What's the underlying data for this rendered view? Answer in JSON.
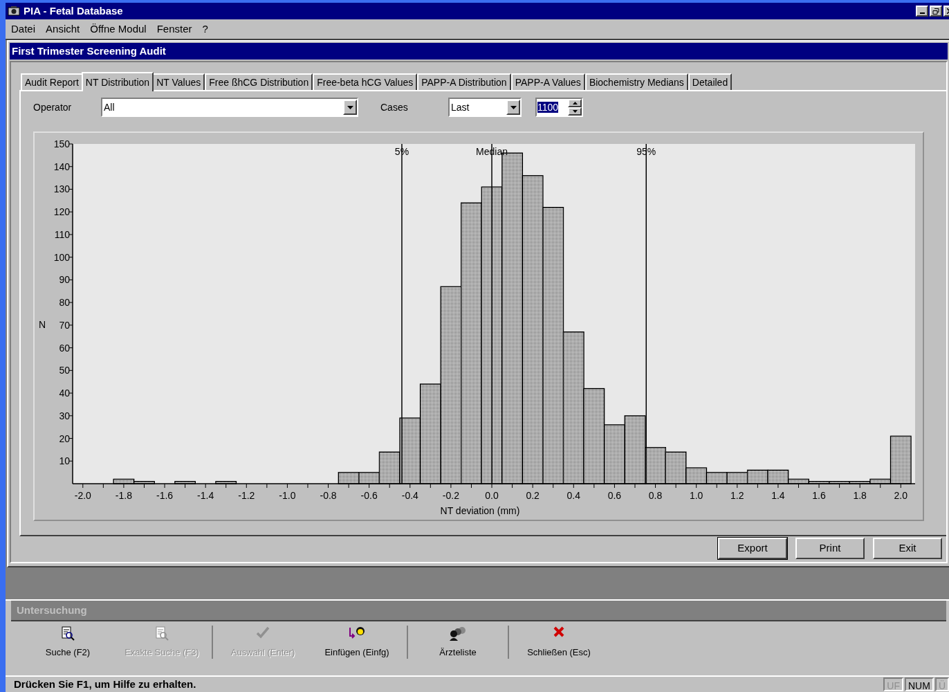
{
  "window": {
    "title": "PIA - Fetal Database"
  },
  "menu": [
    "Datei",
    "Ansicht",
    "Öffne Modul",
    "Fenster",
    "?"
  ],
  "child_window": {
    "title": "First Trimester Screening Audit"
  },
  "tabs": [
    {
      "label": "Audit Report",
      "selected": false
    },
    {
      "label": "NT Distribution",
      "selected": true
    },
    {
      "label": "NT Values",
      "selected": false
    },
    {
      "label": "Free ßhCG Distribution",
      "selected": false
    },
    {
      "label": "Free-beta hCG Values",
      "selected": false
    },
    {
      "label": "PAPP-A Distribution",
      "selected": false
    },
    {
      "label": "PAPP-A Values",
      "selected": false
    },
    {
      "label": "Biochemistry Medians",
      "selected": false
    },
    {
      "label": "Detailed",
      "selected": false
    }
  ],
  "filters": {
    "operator_label": "Operator",
    "operator": "All",
    "cases_label": "Cases",
    "cases": "Last",
    "count": "1100"
  },
  "chart_data": {
    "type": "bar",
    "xlabel": "NT deviation (mm)",
    "ylabel": "N",
    "x": [
      -2.0,
      -1.9,
      -1.8,
      -1.7,
      -1.6,
      -1.5,
      -1.4,
      -1.3,
      -1.2,
      -1.1,
      -1.0,
      -0.9,
      -0.8,
      -0.7,
      -0.6,
      -0.5,
      -0.4,
      -0.3,
      -0.2,
      -0.1,
      0.0,
      0.1,
      0.2,
      0.3,
      0.4,
      0.5,
      0.6,
      0.7,
      0.8,
      0.9,
      1.0,
      1.1,
      1.2,
      1.3,
      1.4,
      1.5,
      1.6,
      1.7,
      1.8,
      1.9,
      2.0
    ],
    "values": [
      0,
      0,
      2,
      1,
      0,
      1,
      0,
      1,
      0,
      0,
      0,
      0,
      0,
      5,
      5,
      14,
      29,
      44,
      87,
      124,
      131,
      146,
      136,
      122,
      67,
      42,
      26,
      30,
      16,
      14,
      7,
      5,
      5,
      6,
      6,
      2,
      1,
      1,
      1,
      2,
      21
    ],
    "xlim": [
      -2.05,
      2.07
    ],
    "ylim": [
      0,
      150
    ],
    "xticks": [
      {
        "value": -2.0,
        "label": "-2.0"
      },
      {
        "value": -1.8,
        "label": "-1.8"
      },
      {
        "value": -1.6,
        "label": "-1.6"
      },
      {
        "value": -1.4,
        "label": "-1.4"
      },
      {
        "value": -1.2,
        "label": "-1.2"
      },
      {
        "value": -1.0,
        "label": "-1.0"
      },
      {
        "value": -0.8,
        "label": "-0.8"
      },
      {
        "value": -0.6,
        "label": "-0.6"
      },
      {
        "value": -0.4,
        "label": "-0.4"
      },
      {
        "value": -0.2,
        "label": "-0.2"
      },
      {
        "value": 0.0,
        "label": "0.0"
      },
      {
        "value": 0.2,
        "label": "0.2"
      },
      {
        "value": 0.4,
        "label": "0.4"
      },
      {
        "value": 0.6,
        "label": "0.6"
      },
      {
        "value": 0.8,
        "label": "0.8"
      },
      {
        "value": 1.0,
        "label": "1.0"
      },
      {
        "value": 1.2,
        "label": "1.2"
      },
      {
        "value": 1.4,
        "label": "1.4"
      },
      {
        "value": 1.6,
        "label": "1.6"
      },
      {
        "value": 1.8,
        "label": "1.8"
      },
      {
        "value": 2.0,
        "label": "2.0"
      }
    ],
    "yticks": [
      10,
      20,
      30,
      40,
      50,
      60,
      70,
      80,
      90,
      100,
      110,
      120,
      130,
      140,
      150
    ],
    "ref_lines": [
      {
        "axis": "x",
        "value": -0.44
      },
      {
        "axis": "x",
        "value": 0.0
      },
      {
        "axis": "x",
        "value": 0.755
      }
    ]
  },
  "ref_line_labels": [
    "5%",
    "Median",
    "95%"
  ],
  "buttons": [
    {
      "label": "Export",
      "default": true
    },
    {
      "label": "Print",
      "default": false
    },
    {
      "label": "Exit",
      "default": false
    }
  ],
  "panel": {
    "title": "Untersuchung"
  },
  "toolbar": [
    [
      {
        "label": "Suche (F2)",
        "kind": "search",
        "disabled": false
      },
      {
        "label": "Exakte Suche (F3)",
        "kind": "search",
        "disabled": true
      }
    ],
    [
      {
        "label": "Auswahl (Enter)",
        "kind": "check",
        "disabled": true
      },
      {
        "label": "Einfügen (Einfg)",
        "kind": "insert",
        "disabled": false
      }
    ],
    [
      {
        "label": "Ärzteliste",
        "kind": "people",
        "disabled": false
      }
    ],
    [
      {
        "label": "Schließen (Esc)",
        "kind": "close",
        "disabled": false
      }
    ]
  ],
  "status_bar": {
    "message": "Drücken Sie F1, um Hilfe zu erhalten.",
    "indicators": [
      {
        "label": "UF",
        "on": false
      },
      {
        "label": "NUM",
        "on": true
      },
      {
        "label": "Ü",
        "on": false
      }
    ]
  }
}
